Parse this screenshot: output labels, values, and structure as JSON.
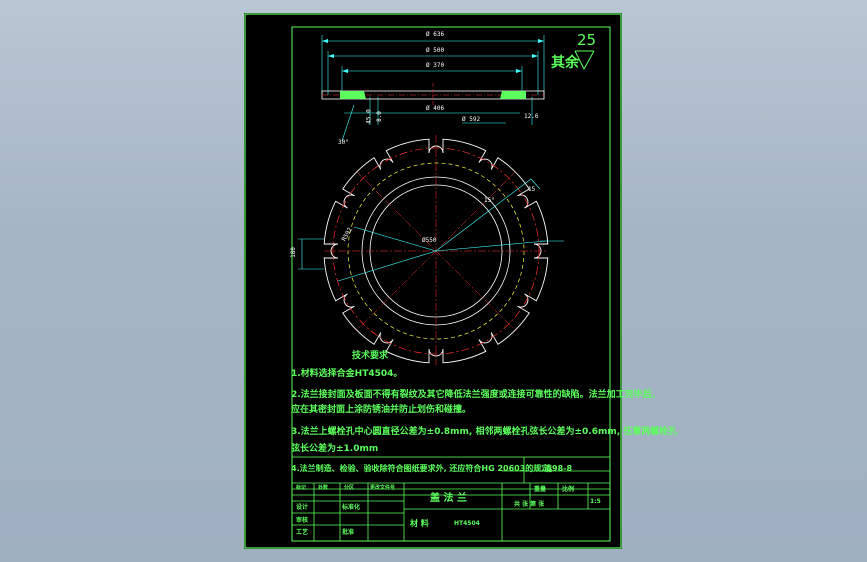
{
  "dimensions": {
    "d_outer": "Ø 636",
    "d_mid": "Ø 500",
    "d_inner": "Ø 370",
    "d_bore": "Ø 406",
    "d_bolt": "Ø 592",
    "thickness": "8.0",
    "chamfer": "12.6",
    "height": "45.0",
    "angle_top": "30°",
    "angle_slot": "15°",
    "slot_width": "15",
    "slot_pitch": "180",
    "r_bolt": "R592",
    "r_center": "Ø550"
  },
  "roughness": {
    "value": "25",
    "label": "其余"
  },
  "tech_requirements": {
    "title": "技术要求",
    "items": [
      "1.材料选择合金HT4504。",
      "2.法兰接封面及板面不得有裂纹及其它降低法兰强度或连接可靠性的缺陷。法兰加工完毕后,",
      "应在其密封面上涂防锈油并防止划伤和碰撞。",
      "3.法兰上螺栓孔中心圆直径公差为±0.8mm, 相邻两螺栓孔弦长公差为±0.6mm, 任意两螺栓孔",
      "弦长公差为±1.0mm",
      "4.法兰制造、检验、验收除符合图纸要求外, 还应符合HG 20603的规定。"
    ]
  },
  "title_block": {
    "drawing_no": "清98-8",
    "part_name": "盖 法 兰",
    "material_label": "材 料",
    "material": "HT4504",
    "weight_label": "重量",
    "scale_label": "比例",
    "scale": "1:5",
    "sheet_label": "共 张 第 张",
    "header_cells": [
      "标记",
      "处数",
      "分区",
      "更改文件号",
      "签名",
      "年月日"
    ],
    "role_cells": [
      "设计",
      "标准化",
      "审核",
      "工艺",
      "批准"
    ]
  },
  "colors": {
    "border": "#5cff5c",
    "geometry": "#ffffff",
    "center_line": "#ff3030",
    "pitch_circle": "#ffff40",
    "dimension": "#40ffff",
    "section_fill": "#5cff5c"
  }
}
